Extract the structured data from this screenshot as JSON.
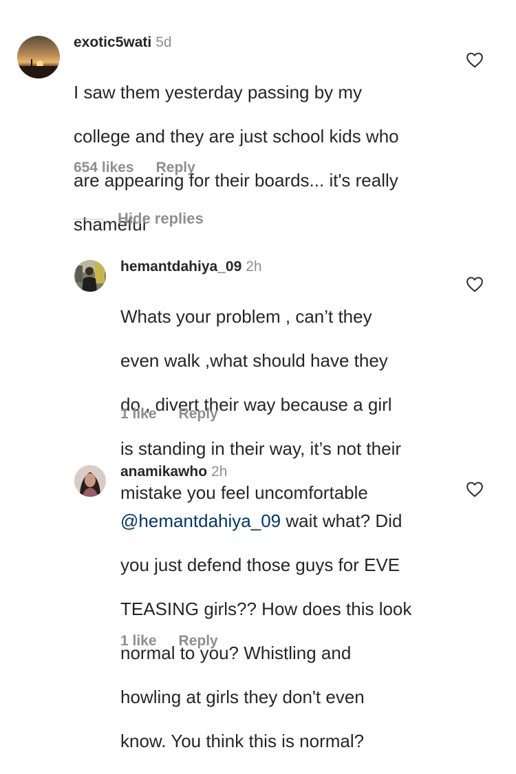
{
  "comments": [
    {
      "username": "exotic5wati",
      "time": "5d",
      "text_lines": [
        "I saw them yesterday passing by my",
        "college and they are just school kids who",
        "are appearing for their boards... it's really",
        "shameful"
      ],
      "likes": "654 likes",
      "reply": "Reply",
      "avatar": "sunset-photo-avatar",
      "like_icon": "heart-outline-icon"
    },
    {
      "username": "hemantdahiya_09",
      "time": "2h",
      "text_lines": [
        "Whats your problem , can’t they",
        "even walk ,what should have they",
        "do , divert their way because a girl",
        "is standing in their way, it’s not their",
        "mistake you feel uncomfortable"
      ],
      "likes": "1 like",
      "reply": "Reply",
      "avatar": "gym-photo-avatar",
      "like_icon": "heart-outline-icon"
    },
    {
      "username": "anamikawho",
      "time": "2h",
      "mention": "@hemantdahiya_09",
      "text_lines": [
        " wait what? Did",
        "you just defend those guys for EVE",
        "TEASING girls?? How does this look",
        "normal to you? Whistling and",
        "howling at girls they don't even",
        "know. You think this is normal?"
      ],
      "likes": "1 like",
      "reply": "Reply",
      "avatar": "portrait-photo-avatar",
      "like_icon": "heart-outline-icon"
    }
  ],
  "hide_replies": "Hide replies",
  "colors": {
    "primary_text": "#262626",
    "secondary_text": "#8e8e8e",
    "mention": "#00376b",
    "divider": "#c7c7c7"
  }
}
